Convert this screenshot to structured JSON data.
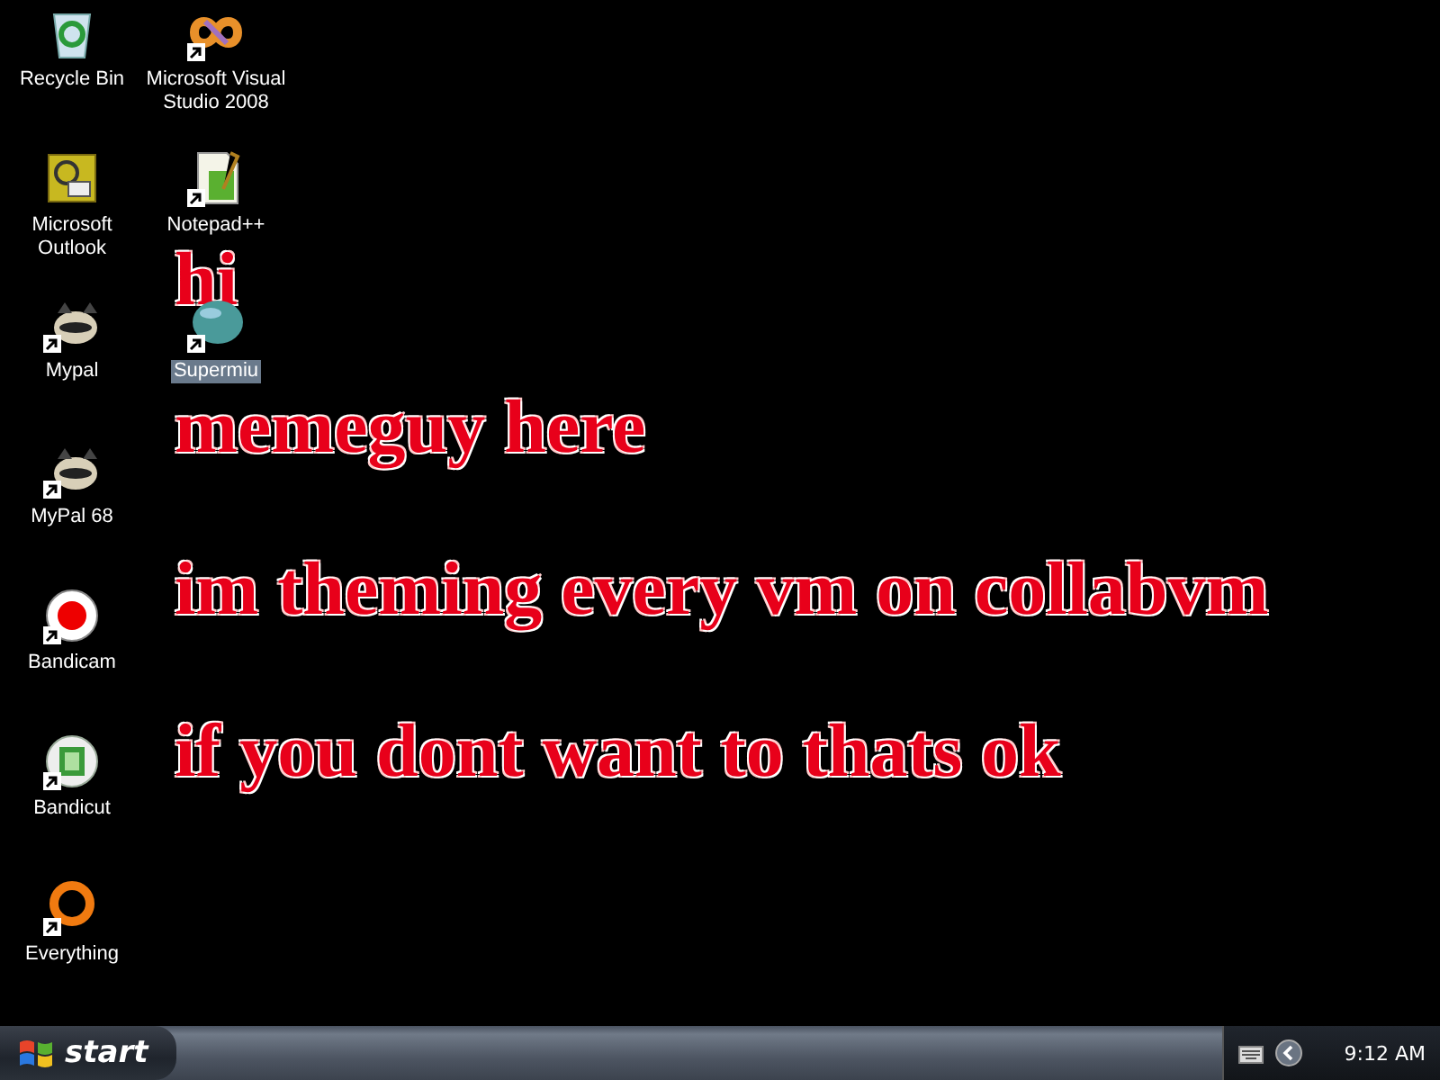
{
  "desktop_icons": [
    {
      "label": "Recycle Bin",
      "kind": "recycle-bin",
      "shortcut": false,
      "selected": false
    },
    {
      "label": "Microsoft Outlook",
      "kind": "outlook",
      "shortcut": false,
      "selected": false
    },
    {
      "label": "Mypal",
      "kind": "raccoon",
      "shortcut": true,
      "selected": false
    },
    {
      "label": "MyPal 68",
      "kind": "raccoon",
      "shortcut": true,
      "selected": false
    },
    {
      "label": "Bandicam",
      "kind": "record",
      "shortcut": true,
      "selected": false
    },
    {
      "label": "Bandicut",
      "kind": "film",
      "shortcut": true,
      "selected": false
    },
    {
      "label": "Everything",
      "kind": "ring",
      "shortcut": true,
      "selected": false
    },
    {
      "label": "Microsoft Visual Studio 2008",
      "kind": "infinity",
      "shortcut": true,
      "selected": false
    },
    {
      "label": "Notepad++",
      "kind": "notepad",
      "shortcut": true,
      "selected": false
    },
    {
      "label": "Supermiu",
      "kind": "sphere",
      "shortcut": true,
      "selected": true
    }
  ],
  "wallpaper_lines": [
    "hi",
    "memeguy here",
    "im theming every vm on collabvm",
    "if you dont want to thats ok"
  ],
  "taskbar": {
    "start_label": "start",
    "clock": "9:12 AM"
  }
}
